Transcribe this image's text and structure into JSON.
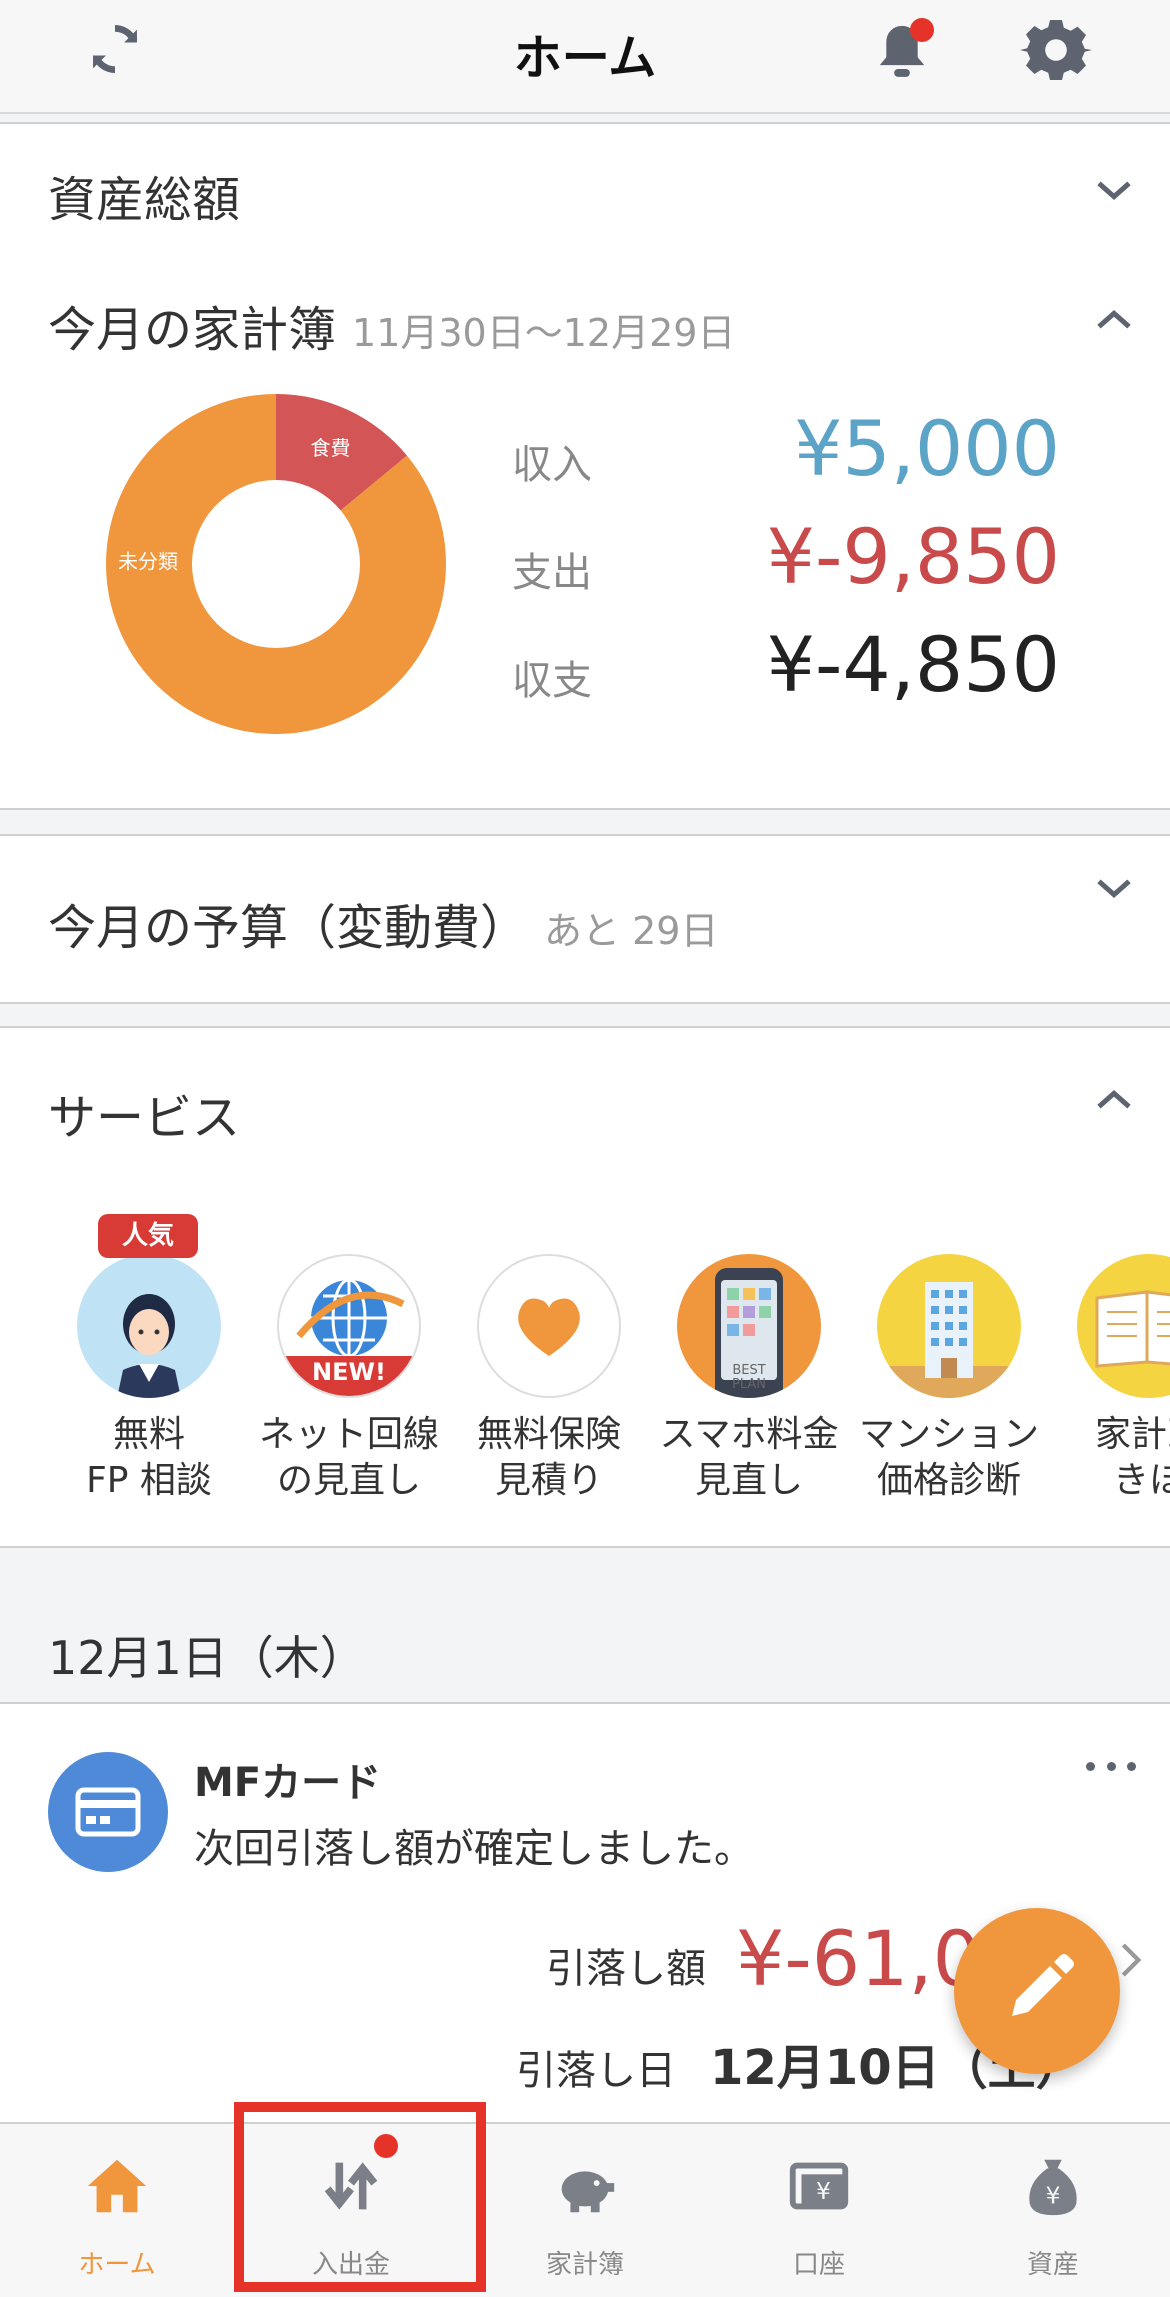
{
  "header": {
    "title": "ホーム"
  },
  "total_assets": {
    "title": "資産総額"
  },
  "household": {
    "title": "今月の家計簿",
    "period": "11月30日〜12月29日",
    "donut": [
      {
        "label": "食費",
        "fraction": 0.14,
        "color": "#d45555"
      },
      {
        "label": "未分類",
        "fraction": 0.86,
        "color": "#f0963c"
      }
    ],
    "income_label": "収入",
    "income_value": "¥5,000",
    "expense_label": "支出",
    "expense_value": "¥-9,850",
    "balance_label": "収支",
    "balance_value": "¥-4,850"
  },
  "budget": {
    "title": "今月の予算（変動費）",
    "remaining": "あと 29日"
  },
  "services": {
    "title": "サービス",
    "popular_badge": "人気",
    "new_badge": "NEW!",
    "plan_text": "BEST PLAN",
    "items": [
      {
        "line1": "無料",
        "line2": "FP 相談"
      },
      {
        "line1": "ネット回線",
        "line2": "の見直し"
      },
      {
        "line1": "無料保険",
        "line2": "見積り"
      },
      {
        "line1": "スマホ料金",
        "line2": "見直し"
      },
      {
        "line1": "マンション",
        "line2": "価格診断"
      },
      {
        "line1": "家計改",
        "line2": "きほ"
      }
    ]
  },
  "feed": {
    "date": "12月1日（木）",
    "card": {
      "title": "MFカード",
      "message": "次回引落し額が確定しました。",
      "amount_label": "引落し額",
      "amount_value": "¥-61,0",
      "date_label": "引落し日",
      "date_value": "12月10日（土）"
    }
  },
  "tabs": [
    {
      "label": "ホーム"
    },
    {
      "label": "入出金"
    },
    {
      "label": "家計簿"
    },
    {
      "label": "口座"
    },
    {
      "label": "資産"
    }
  ],
  "colors": {
    "accent": "#f0963c",
    "income": "#5ba4c8",
    "expense": "#c94a4a",
    "highlight": "#e5332a"
  }
}
